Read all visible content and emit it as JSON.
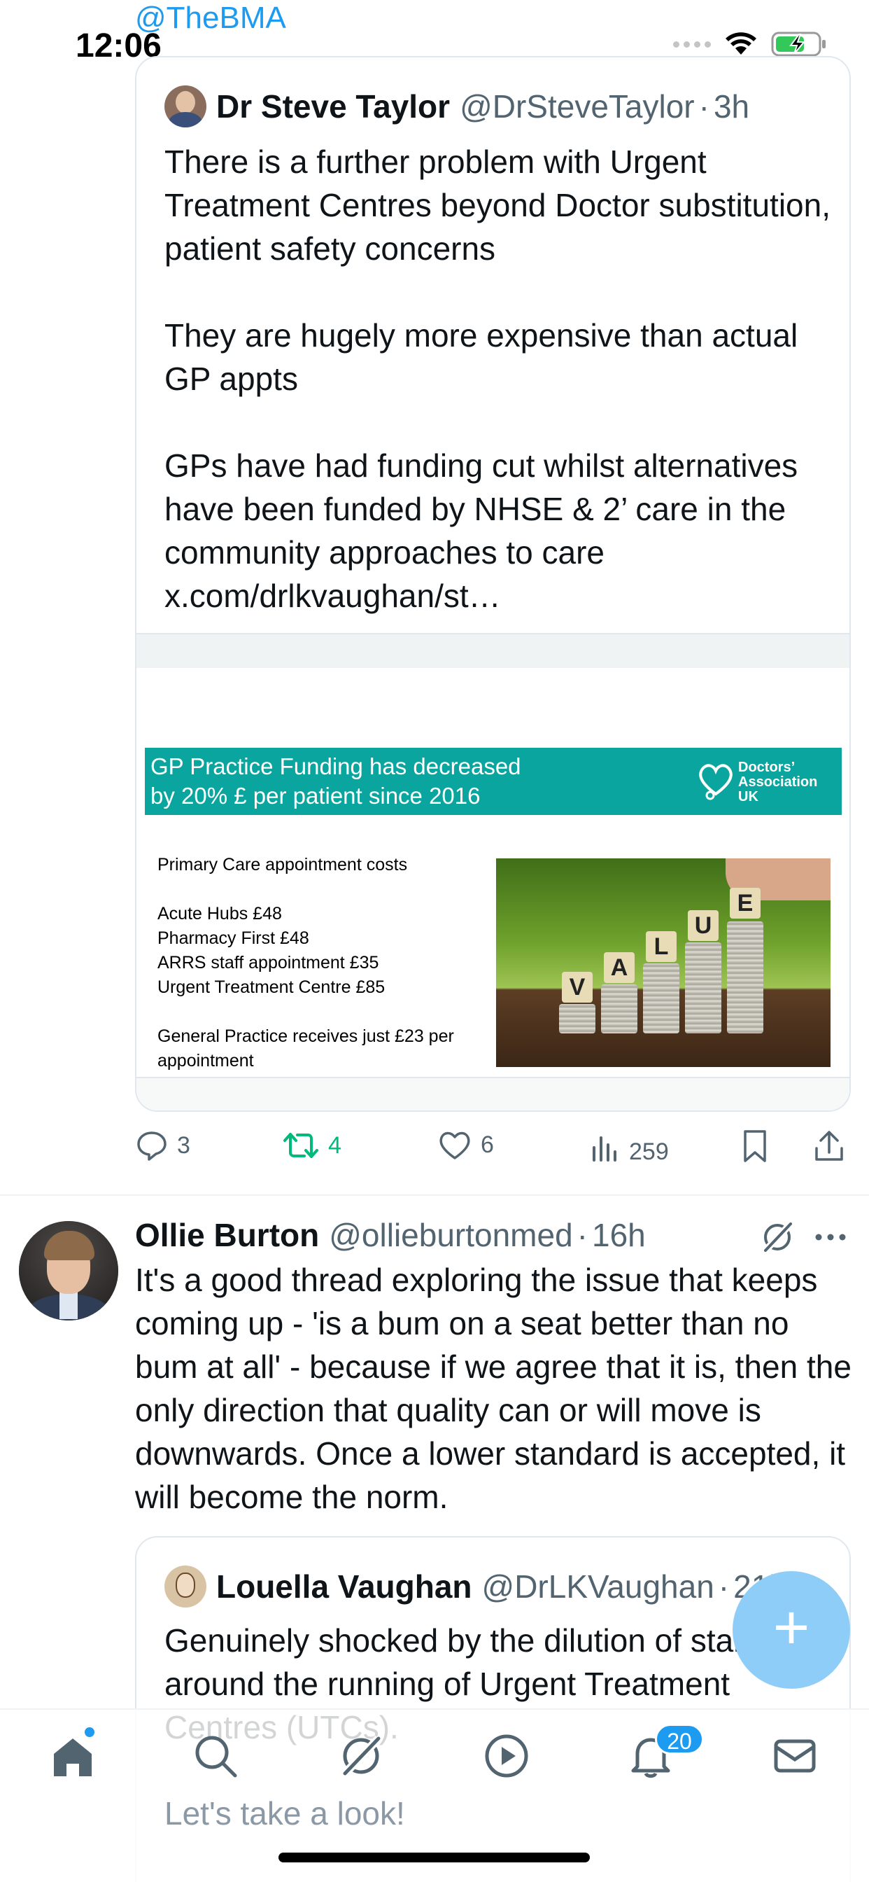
{
  "status_bar": {
    "time": "12:06",
    "overflow_handle": "@TheBMA"
  },
  "quoted_tweet_1": {
    "author_name": "Dr Steve Taylor",
    "author_handle": "@DrSteveTaylor",
    "separator": "·",
    "time_ago": "3h",
    "text": "There is a further problem with Urgent Treatment Centres beyond Doctor substitution, patient safety concerns\n\nThey are hugely more expensive than actual GP appts\n\nGPs have had funding cut whilst alternatives have been funded by NHSE & 2’ care in the community approaches to care x.com/drlkvaughan/st…",
    "media": {
      "banner_text": "GP Practice Funding has decreased\nby 20% £ per patient since 2016",
      "logo_text": "Doctors’\nAssociation\nUK",
      "lines": [
        "Primary Care appointment costs",
        "",
        "Acute Hubs £48",
        "Pharmacy First £48",
        "ARRS staff appointment £35",
        "Urgent Treatment Centre £85",
        "",
        "General Practice receives just £23 per appointment"
      ],
      "image_letters": [
        "V",
        "A",
        "L",
        "U",
        "E"
      ],
      "banner_color": "#0aa59e"
    }
  },
  "tweet_1_actions": {
    "replies": "3",
    "retweets": "4",
    "likes": "6",
    "views": "259",
    "retweet_color": "#00ba7c"
  },
  "tweet_2": {
    "author_name": "Ollie Burton",
    "author_handle": "@ollieburtonmed",
    "separator": "·",
    "time_ago": "16h",
    "text": "It's a good thread exploring the issue that keeps coming up - 'is a bum on a seat better than no bum at all' - because if we agree that it is, then the only direction that quality can or will move is downwards. Once a lower standard is accepted, it will become the norm."
  },
  "quoted_tweet_2": {
    "author_name": "Louella Vaughan",
    "author_handle": "@DrLKVaughan",
    "separator": "·",
    "time_ago": "21h",
    "text": "Genuinely shocked by the dilution of standards around the running of Urgent Treatment Centres (UTCs)."
  },
  "fab": {
    "label": "+"
  },
  "bottom_nav": {
    "items": [
      "home-icon",
      "search-icon",
      "grok-icon",
      "video-icon",
      "notifications-icon",
      "messages-icon"
    ],
    "notifications_badge": "20",
    "compose_hint": "Let's take a look!",
    "accent": "#1d9bf0"
  }
}
